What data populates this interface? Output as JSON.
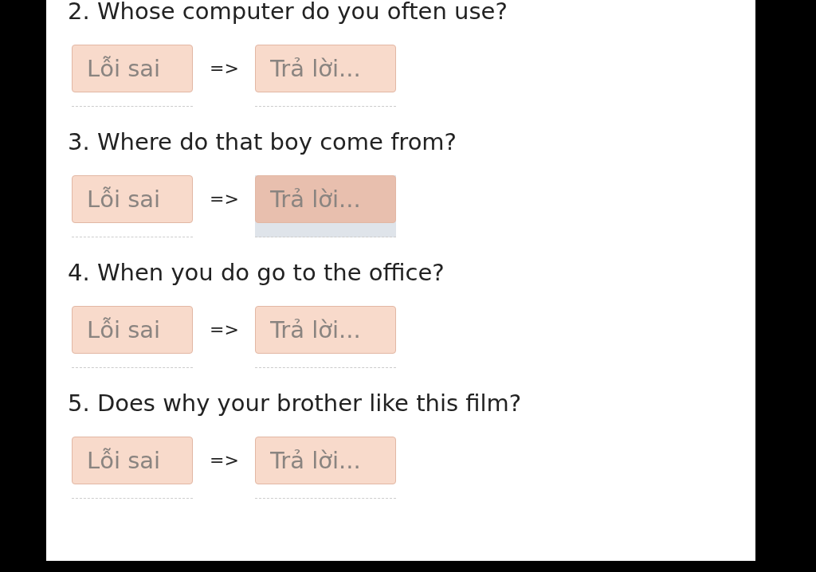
{
  "questions": [
    {
      "text": "2. Whose computer do you often use?",
      "error_field": {
        "placeholder": "Lỗi sai"
      },
      "arrow": "=>",
      "answer_field": {
        "placeholder": "Trả lời...",
        "focused": false
      }
    },
    {
      "text": "3. Where do that boy come from?",
      "error_field": {
        "placeholder": "Lỗi sai"
      },
      "arrow": "=>",
      "answer_field": {
        "placeholder": "Trả lời...",
        "focused": true
      }
    },
    {
      "text": "4. When you do go to the office?",
      "error_field": {
        "placeholder": "Lỗi sai"
      },
      "arrow": "=>",
      "answer_field": {
        "placeholder": "Trả lời...",
        "focused": false
      }
    },
    {
      "text": "5. Does why your brother like this film?",
      "error_field": {
        "placeholder": "Lỗi sai"
      },
      "arrow": "=>",
      "answer_field": {
        "placeholder": "Trả lời...",
        "focused": false
      }
    }
  ]
}
